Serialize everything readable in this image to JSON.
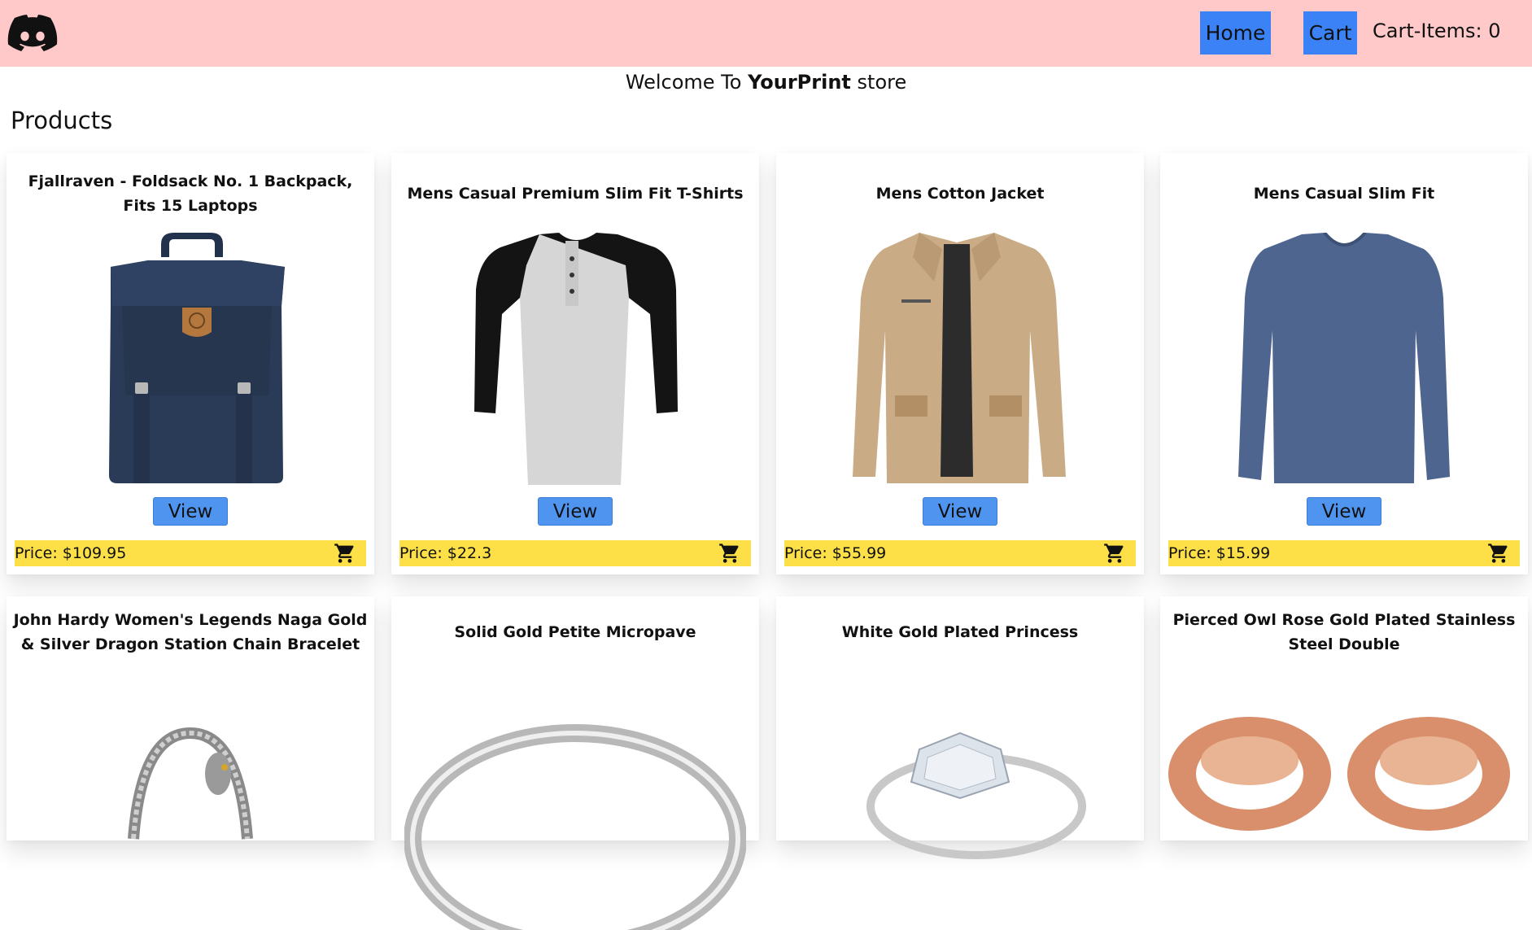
{
  "navbar": {
    "logo_icon": "discord-logo-icon",
    "home_label": "Home",
    "cart_label": "Cart",
    "cart_items_text": "Cart-Items: 0",
    "background": "#ffc9c9",
    "button_color": "#3b82f6"
  },
  "welcome": {
    "prefix": "Welcome To",
    "brand": "YourPrint",
    "suffix": "store"
  },
  "products_heading": "Products",
  "price_bar_color": "#fde047",
  "products": [
    {
      "title": "Fjallraven - Foldsack No. 1 Backpack, Fits 15 Laptops",
      "image": "navy-backpack",
      "view_label": "View",
      "price": "Price: $109.95",
      "cart_icon": "cart-icon"
    },
    {
      "title": "Mens Casual Premium Slim Fit T-Shirts",
      "image": "raglan-tshirt",
      "view_label": "View",
      "price": "Price: $22.3",
      "cart_icon": "cart-icon"
    },
    {
      "title": "Mens Cotton Jacket",
      "image": "khaki-jacket",
      "view_label": "View",
      "price": "Price: $55.99",
      "cart_icon": "cart-icon"
    },
    {
      "title": "Mens Casual Slim Fit",
      "image": "blue-long-sleeve-shirt",
      "view_label": "View",
      "price": "Price: $15.99",
      "cart_icon": "cart-icon"
    },
    {
      "title": "John Hardy Women's Legends Naga Gold & Silver Dragon Station Chain Bracelet",
      "image": "dragon-bracelet"
    },
    {
      "title": "Solid Gold Petite Micropave",
      "image": "silver-ring"
    },
    {
      "title": "White Gold Plated Princess",
      "image": "diamond-ring"
    },
    {
      "title": "Pierced Owl Rose Gold Plated Stainless Steel Double",
      "image": "rose-gold-plugs"
    }
  ]
}
